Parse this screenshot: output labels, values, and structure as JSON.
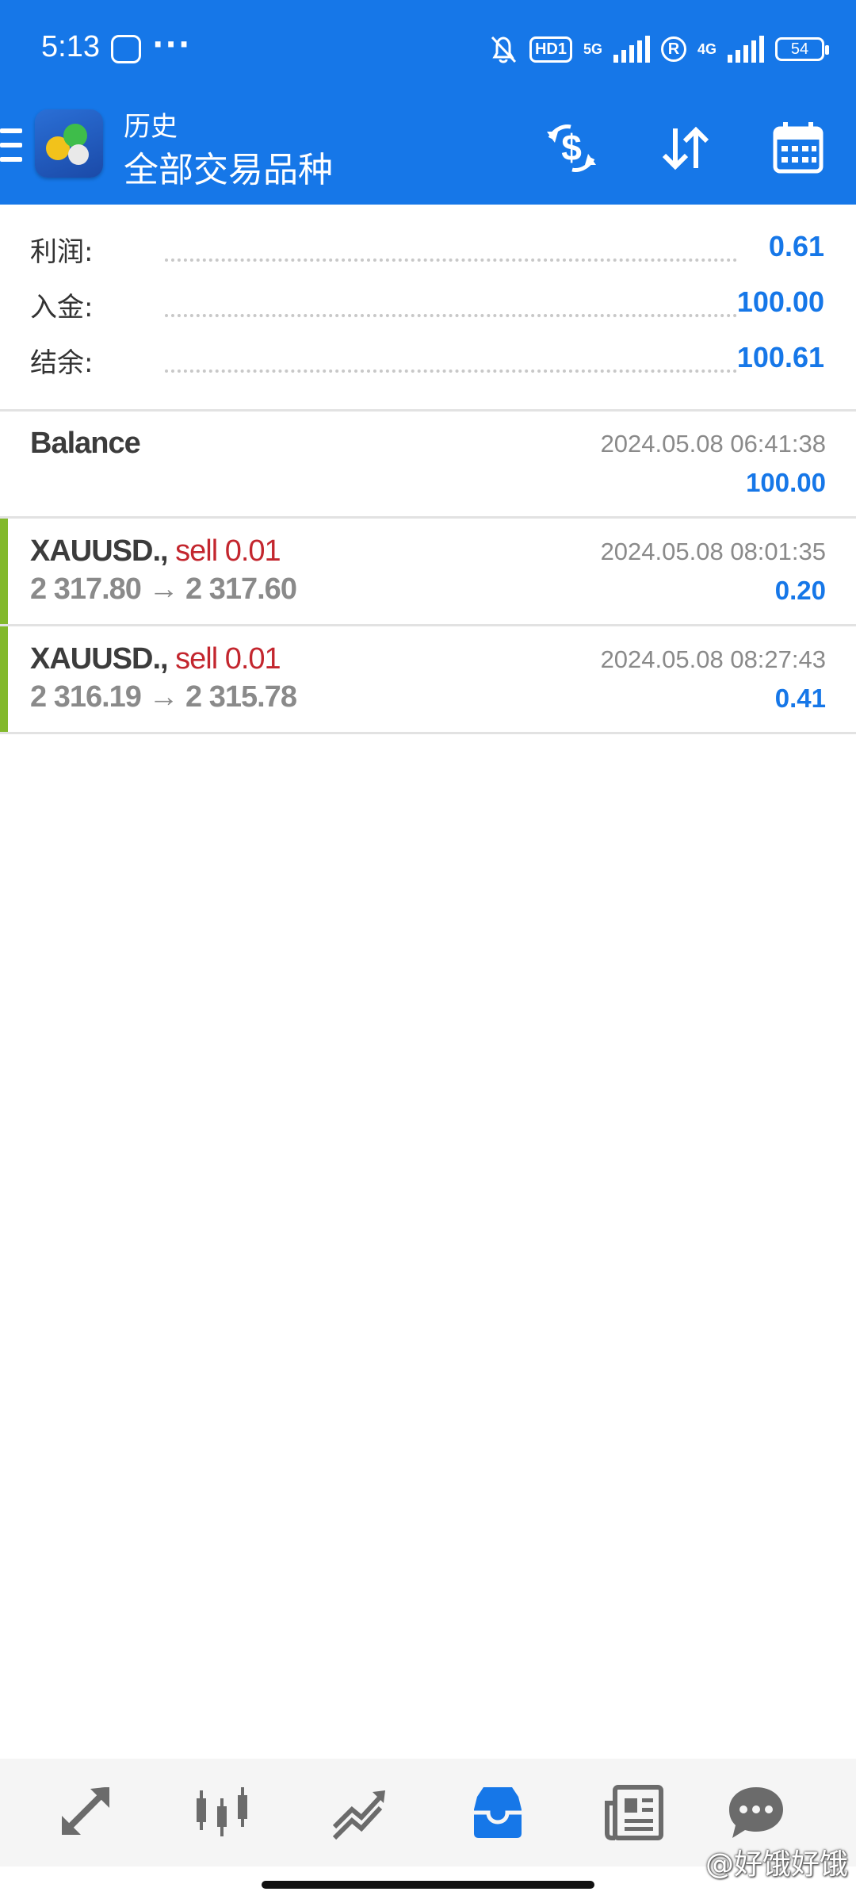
{
  "status_bar": {
    "time": "5:13",
    "hd_label": "HD1",
    "net1": "5G",
    "roaming": "R",
    "net2": "4G",
    "battery": "54"
  },
  "header": {
    "subtitle": "历史",
    "title": "全部交易品种",
    "icons": [
      "dollar-refresh-icon",
      "sort-icon",
      "calendar-icon"
    ]
  },
  "summary": {
    "profit": {
      "label": "利润:",
      "value": "0.61"
    },
    "deposit": {
      "label": "入金:",
      "value": "100.00"
    },
    "balance": {
      "label": "结余:",
      "value": "100.61"
    }
  },
  "balance_entry": {
    "title": "Balance",
    "time": "2024.05.08 06:41:38",
    "amount": "100.00"
  },
  "deals": [
    {
      "symbol": "XAUUSD.,",
      "side": "sell 0.01",
      "prices": "2 317.80 → 2 317.60",
      "time": "2024.05.08 08:01:35",
      "profit": "0.20"
    },
    {
      "symbol": "XAUUSD.,",
      "side": "sell 0.01",
      "prices": "2 316.19 → 2 315.78",
      "time": "2024.05.08 08:27:43",
      "profit": "0.41"
    }
  ],
  "bottom_nav": [
    "quotes-icon",
    "chart-icon",
    "trade-icon",
    "history-icon",
    "news-icon",
    "chat-icon"
  ],
  "active_nav": "history-icon",
  "watermark": "@好饿好饿",
  "colors": {
    "primary": "#1677e8",
    "sell": "#c3262e",
    "deal_bar": "#82b92b"
  }
}
